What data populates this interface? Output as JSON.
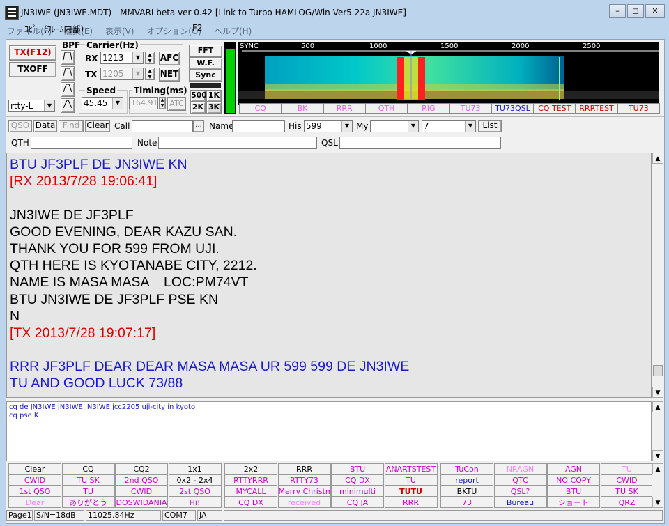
{
  "window": {
    "title": "JN3IWE (JN3IWE.MDT) - MMVARI beta ver 0.42 [Link to Turbo HAMLOG/Win Ver5.22a JN3IWE]",
    "min": "–",
    "max": "◻",
    "close": "✕"
  },
  "menu": {
    "items": [
      "ファイル(F)",
      "編集(E)",
      "表示(V)",
      "オプション(O)",
      "ヘルプ(H)"
    ],
    "overlay": "ｺﾋﾟｰ (ﾌﾚｰﾑ内部)",
    "f2": "F2"
  },
  "toolbar": {
    "tx": "TX(F12)",
    "txoff": "TXOFF",
    "mode": "rtty-L",
    "bpf": "BPF",
    "carrier_label": "Carrier(Hz)",
    "rx_label": "RX",
    "rx_value": "1213",
    "tx_label": "TX",
    "tx_value": "1205",
    "afc": "AFC",
    "net": "NET",
    "speed_label": "Speed",
    "speed_value": "45.45",
    "timing_label": "Timing(ms)",
    "timing_value": "164.91",
    "atc": "ATC",
    "fft": "FFT",
    "wf": "W.F.",
    "sync": "Sync",
    "b500": "500",
    "b1k": "1K",
    "b2k": "2K",
    "b3k": "3K"
  },
  "spectrum": {
    "scale": [
      "SYNC",
      "500",
      "1000",
      "1500",
      "2000",
      "2500"
    ],
    "macros": [
      {
        "label": "CQ",
        "color": "#e060e0"
      },
      {
        "label": "BK",
        "color": "#e060e0"
      },
      {
        "label": "RRR",
        "color": "#e060e0"
      },
      {
        "label": "QTH",
        "color": "#e060e0"
      },
      {
        "label": "RIG",
        "color": "#e060e0"
      },
      {
        "label": "TU73",
        "color": "#e060e0"
      },
      {
        "label": "TU73QSL",
        "color": "#1a1acc"
      },
      {
        "label": "CQ TEST",
        "color": "#d00000"
      },
      {
        "label": "RRRTEST",
        "color": "#d00000"
      },
      {
        "label": "TU73",
        "color": "#d00000"
      }
    ]
  },
  "log": {
    "qso": "QSO",
    "data": "Data",
    "find": "Find",
    "clear": "Clear",
    "call_label": "Call",
    "call_value": "",
    "browse": "...",
    "name_label": "Name",
    "name_value": "",
    "his_label": "His",
    "his_value": "599",
    "my_label": "My",
    "my_value": "",
    "band_value": "7",
    "list": "List",
    "qth_label": "QTH",
    "qth_value": "",
    "note_label": "Note",
    "note_value": "",
    "qsl_label": "QSL",
    "qsl_value": ""
  },
  "rx_text": [
    {
      "text": "BTU JF3PLF DE JN3IWE KN",
      "color": "blue"
    },
    {
      "text": "[RX 2013/7/28 19:06:41]",
      "color": "red"
    },
    {
      "text": "",
      "color": "black"
    },
    {
      "text": "JN3IWE DE JF3PLF",
      "color": "black"
    },
    {
      "text": "GOOD EVENING, DEAR KAZU SAN.",
      "color": "black"
    },
    {
      "text": "THANK YOU FOR 599 FROM UJI.",
      "color": "black"
    },
    {
      "text": "QTH HERE IS KYOTANABE CITY, 2212.",
      "color": "black"
    },
    {
      "text": "NAME IS MASA MASA    LOC:PM74VT",
      "color": "black"
    },
    {
      "text": "BTU JN3IWE DE JF3PLF PSE KN",
      "color": "black"
    },
    {
      "text": "N",
      "color": "black"
    },
    {
      "text": "[TX 2013/7/28 19:07:17]",
      "color": "red"
    },
    {
      "text": "",
      "color": "black"
    },
    {
      "text": "RRR JF3PLF DEAR DEAR MASA MASA UR 599 599 DE JN3IWE",
      "color": "blue"
    },
    {
      "text": "TU AND GOOD LUCK 73/88",
      "color": "blue"
    }
  ],
  "tx_text": [
    "cq de JN3IWE JN3IWE JN3IWE jcc2205 uji-city in kyoto",
    "cq pse K"
  ],
  "macro_buttons": [
    [
      [
        "Clear",
        "#000"
      ],
      [
        "CQ",
        "#000"
      ],
      [
        "CQ2",
        "#000"
      ],
      [
        "1x1",
        "#000"
      ],
      [
        "CWID",
        "#d000d0"
      ],
      [
        "TU SK",
        "#d000d0"
      ],
      [
        "2nd QSO",
        "#d000d0"
      ],
      [
        "0x2 - 2x4",
        "#000"
      ],
      [
        "1st QSO",
        "#d000d0"
      ],
      [
        "TU",
        "#d000d0"
      ],
      [
        "CWID",
        "#d000d0"
      ],
      [
        "2st QSO",
        "#d000d0"
      ],
      [
        "Dear",
        "#ff80ff"
      ],
      [
        "ありがとう",
        "#d000d0"
      ],
      [
        "DOSWIDANIA",
        "#d000d0"
      ],
      [
        "Hi!",
        "#d000d0"
      ]
    ],
    [
      [
        "2x2",
        "#000"
      ],
      [
        "RRR",
        "#000"
      ],
      [
        "BTU",
        "#d000d0"
      ],
      [
        "ANARTSTEST",
        "#d000d0"
      ],
      [
        "RTTYRRR",
        "#d000d0"
      ],
      [
        "RTTY73",
        "#d000d0"
      ],
      [
        "CQ DX",
        "#d000d0"
      ],
      [
        "TU",
        "#d000d0"
      ],
      [
        "MYCALL",
        "#d000d0"
      ],
      [
        "Merry Christmas",
        "#d000d0"
      ],
      [
        "minimulti",
        "#d000d0"
      ],
      [
        "TUTU",
        "#d00000"
      ],
      [
        "CQ DX",
        "#d000d0"
      ],
      [
        "received",
        "#ff80ff"
      ],
      [
        "CQ JA",
        "#d000d0"
      ],
      [
        "RRR",
        "#d000d0"
      ]
    ],
    [
      [
        "TuCon",
        "#d000d0"
      ],
      [
        "NRAGN",
        "#ff80ff"
      ],
      [
        "AGN",
        "#d000d0"
      ],
      [
        "TU",
        "#ff80ff"
      ],
      [
        "report",
        "#1a1acc"
      ],
      [
        "QTC",
        "#d000d0"
      ],
      [
        "NO COPY",
        "#d000d0"
      ],
      [
        "CWID",
        "#d000d0"
      ],
      [
        "BKTU",
        "#000"
      ],
      [
        "QSL?",
        "#d000d0"
      ],
      [
        "BTU",
        "#d000d0"
      ],
      [
        "TU SK",
        "#d000d0"
      ],
      [
        "73",
        "#d000d0"
      ],
      [
        "Bureau",
        "#1a1acc"
      ],
      [
        "ショート",
        "#d000d0"
      ],
      [
        "QRZ",
        "#d000d0"
      ]
    ]
  ],
  "status": {
    "page": "Page1",
    "sn": "S/N=18dB",
    "clock": "11025.84Hz",
    "com": "COM7",
    "lang": "JA"
  }
}
